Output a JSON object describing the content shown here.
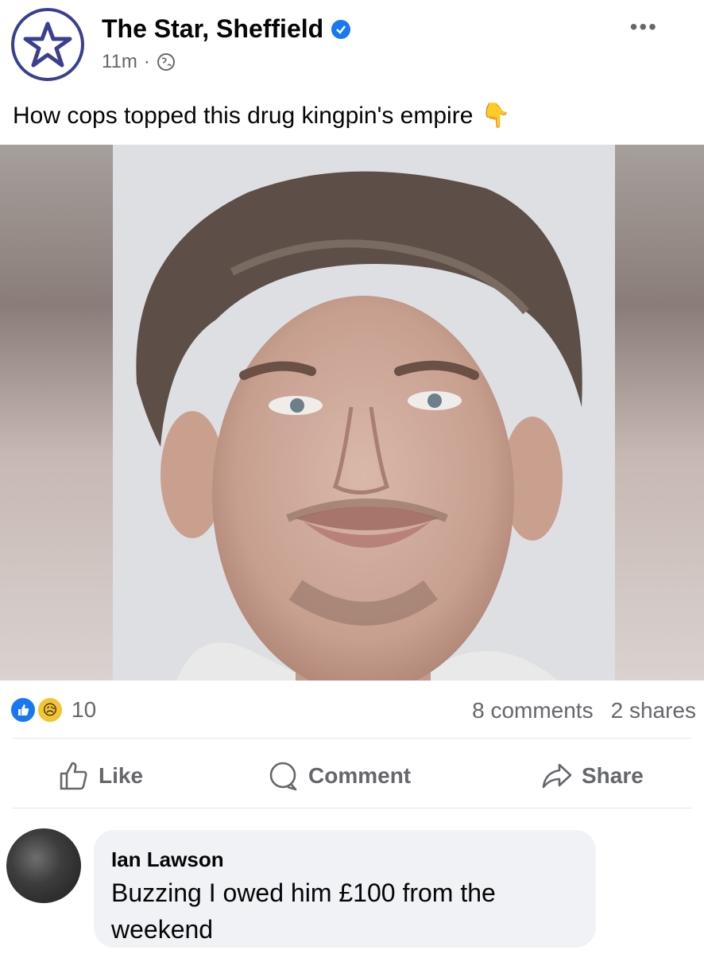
{
  "post": {
    "page_name": "The Star, Sheffield",
    "time": "11m",
    "caption": "How cops topped this drug kingpin's empire"
  },
  "stats": {
    "reaction_count": "10",
    "comments": "8 comments",
    "shares": "2 shares"
  },
  "actions": {
    "like": "Like",
    "comment": "Comment",
    "share": "Share"
  },
  "comment": {
    "author": "Ian Lawson",
    "text": "Buzzing I owed him £100 from the weekend"
  },
  "colors": {
    "brand_blue": "#1877f2",
    "page_logo": "#3a3f8f",
    "muted_text": "#65676b",
    "bubble": "#f0f2f5"
  },
  "icons": [
    "star-logo-icon",
    "verified-badge-icon",
    "globe-icon",
    "more-options-icon",
    "pointing-down-emoji",
    "like-reaction-icon",
    "sad-reaction-icon",
    "thumbs-up-icon",
    "comment-icon",
    "share-icon"
  ]
}
